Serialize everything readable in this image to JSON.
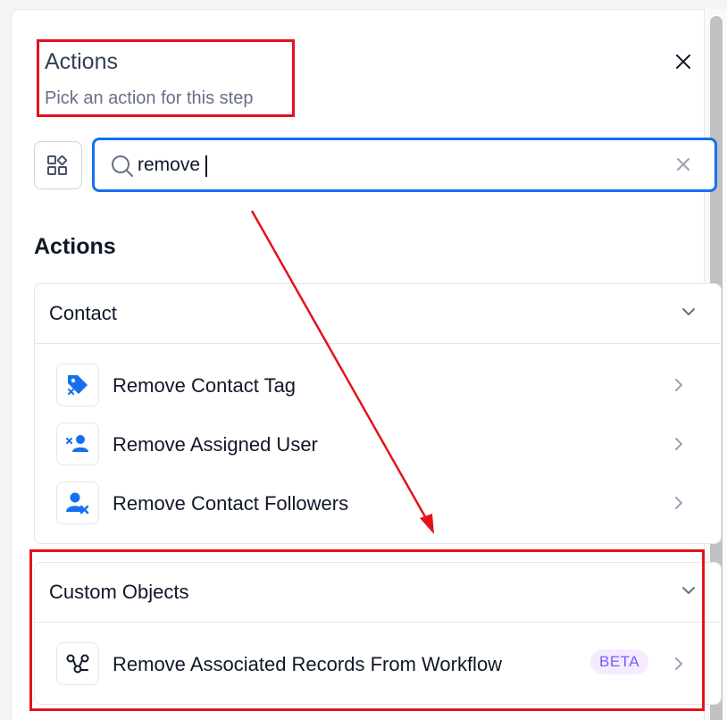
{
  "header": {
    "title": "Actions",
    "subtitle": "Pick an action for this step"
  },
  "search": {
    "value": "remove"
  },
  "section_heading": "Actions",
  "groups": [
    {
      "title": "Contact",
      "items": [
        {
          "label": "Remove Contact Tag",
          "icon": "tag-remove-icon"
        },
        {
          "label": "Remove Assigned User",
          "icon": "user-remove-icon"
        },
        {
          "label": "Remove Contact Followers",
          "icon": "users-remove-icon"
        }
      ]
    },
    {
      "title": "Custom Objects",
      "items": [
        {
          "label": "Remove Associated Records From Workflow",
          "icon": "association-icon",
          "badge": "BETA"
        }
      ]
    }
  ],
  "colors": {
    "accent": "#1570ef",
    "annotation": "#e4121b",
    "badge_bg": "#f4ebff",
    "badge_text": "#7a5af8"
  }
}
